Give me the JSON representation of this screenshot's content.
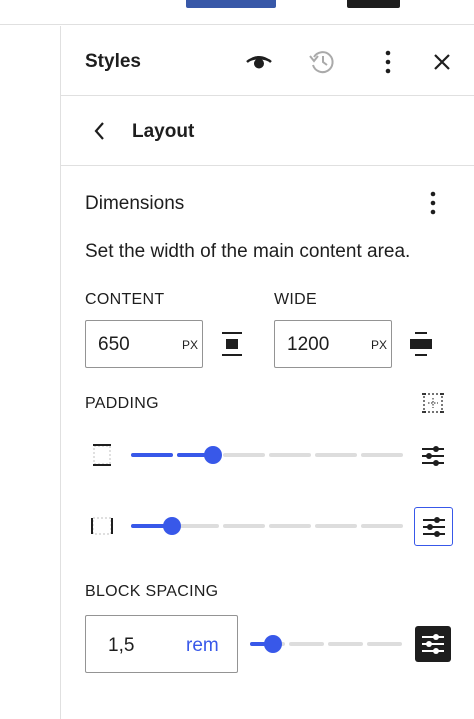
{
  "header": {
    "title": "Styles"
  },
  "nav": {
    "title": "Layout"
  },
  "dimensions": {
    "title": "Dimensions",
    "description": "Set the width of the main content area.",
    "content_label": "CONTENT",
    "content_value": "650",
    "content_unit": "PX",
    "wide_label": "WIDE",
    "wide_value": "1200",
    "wide_unit": "PX",
    "padding_label": "PADDING",
    "padding_vertical_level": 0.3,
    "padding_horizontal_level": 0.15,
    "block_spacing_label": "BLOCK SPACING",
    "block_spacing_value": "1,5",
    "block_spacing_unit": "rem",
    "block_spacing_level": 0.15
  },
  "colors": {
    "accent": "#3858e9",
    "track": "#dddddd",
    "border": "#e0e0e0",
    "text": "#1e1e1e"
  },
  "icons": [
    "eye-icon",
    "revisions-icon",
    "more-vertical-icon",
    "close-icon",
    "chevron-left-icon",
    "content-width-icon",
    "wide-width-icon",
    "padding-sides-icon",
    "vertical-padding-icon",
    "horizontal-padding-icon",
    "sliders-icon"
  ]
}
